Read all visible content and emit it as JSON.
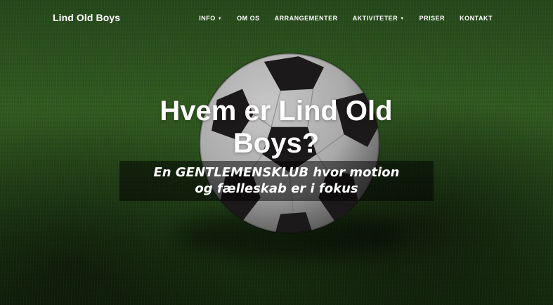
{
  "brand": "Lind Old Boys",
  "nav": [
    {
      "label": "INFO",
      "dropdown": true
    },
    {
      "label": "OM OS",
      "dropdown": false
    },
    {
      "label": "ARRANGEMENTER",
      "dropdown": false
    },
    {
      "label": "AKTIVITETER",
      "dropdown": true
    },
    {
      "label": "PRISER",
      "dropdown": false
    },
    {
      "label": "KONTAKT",
      "dropdown": false
    }
  ],
  "hero": {
    "headline": "Hvem er Lind Old Boys?",
    "subtitle": "En GENTLEMENSKLUB hvor motion og fælleskab er i fokus"
  },
  "colors": {
    "text": "#ffffff",
    "grass": "#3d7028",
    "overlay": "rgba(0,0,0,0.5)"
  }
}
